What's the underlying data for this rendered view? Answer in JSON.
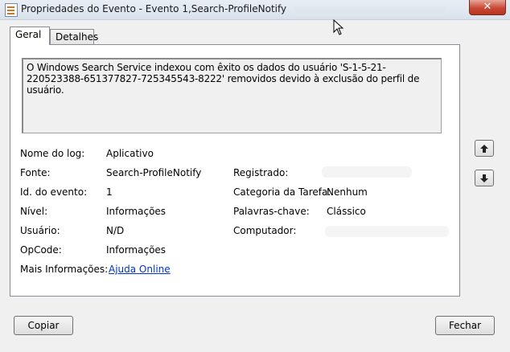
{
  "window": {
    "title": "Propriedades do Evento - Evento 1,Search-ProfileNotify",
    "close_glyph": "✕"
  },
  "tabs": [
    {
      "label": "Geral",
      "active": true
    },
    {
      "label": "Detalhes",
      "active": false
    }
  ],
  "description": "O Windows Search Service indexou com êxito os dados do usuário 'S-1-5-21-220523388-651377827-725345543-8222' removidos devido à exclusão do perfil de usuário.",
  "fields": {
    "log_name": {
      "label": "Nome do log:",
      "value": "Aplicativo"
    },
    "source": {
      "label": "Fonte:",
      "value": "Search-ProfileNotify"
    },
    "event_id": {
      "label": "Id. do evento:",
      "value": "1"
    },
    "level": {
      "label": "Nível:",
      "value": "Informações"
    },
    "user": {
      "label": "Usuário:",
      "value": "N/D"
    },
    "opcode": {
      "label": "OpCode:",
      "value": "Informações"
    },
    "more_info": {
      "label": "Mais Informações:",
      "value": "Ajuda Online"
    },
    "logged": {
      "label": "Registrado:",
      "value": ""
    },
    "task_category": {
      "label": "Categoria da Tarefa:",
      "value": "Nenhum"
    },
    "keywords": {
      "label": "Palavras-chave:",
      "value": "Clássico"
    },
    "computer": {
      "label": "Computador:",
      "value": ""
    }
  },
  "nav": {
    "up_icon": "arrow-up-icon",
    "down_icon": "arrow-down-icon"
  },
  "buttons": {
    "copy": "Copiar",
    "close": "Fechar"
  }
}
